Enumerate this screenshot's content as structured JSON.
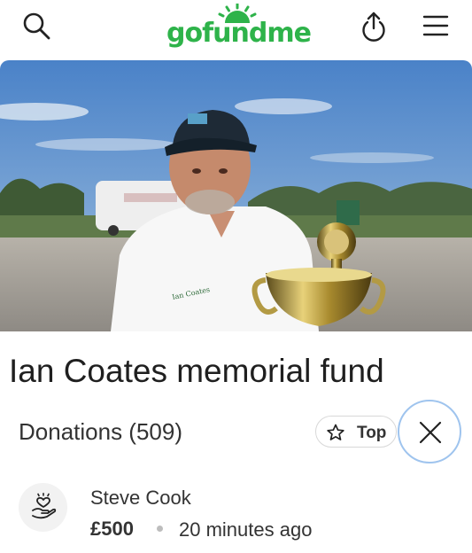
{
  "header": {
    "logo_text": "gofundme",
    "search_icon": "search-icon",
    "share_icon": "share-icon",
    "menu_icon": "hamburger-menu-icon",
    "brand_color": "#2eb34a"
  },
  "hero": {
    "shirt_text": "Ian Coates"
  },
  "fundraiser": {
    "title": "Ian Coates memorial fund"
  },
  "donations": {
    "heading": "Donations (509)",
    "sort_label": "Top",
    "sort_icon": "star-icon",
    "close_icon": "close-icon",
    "items": [
      {
        "name": "Steve Cook",
        "amount": "£500",
        "time": "20 minutes ago",
        "avatar_icon": "heart-hand-icon"
      }
    ]
  }
}
